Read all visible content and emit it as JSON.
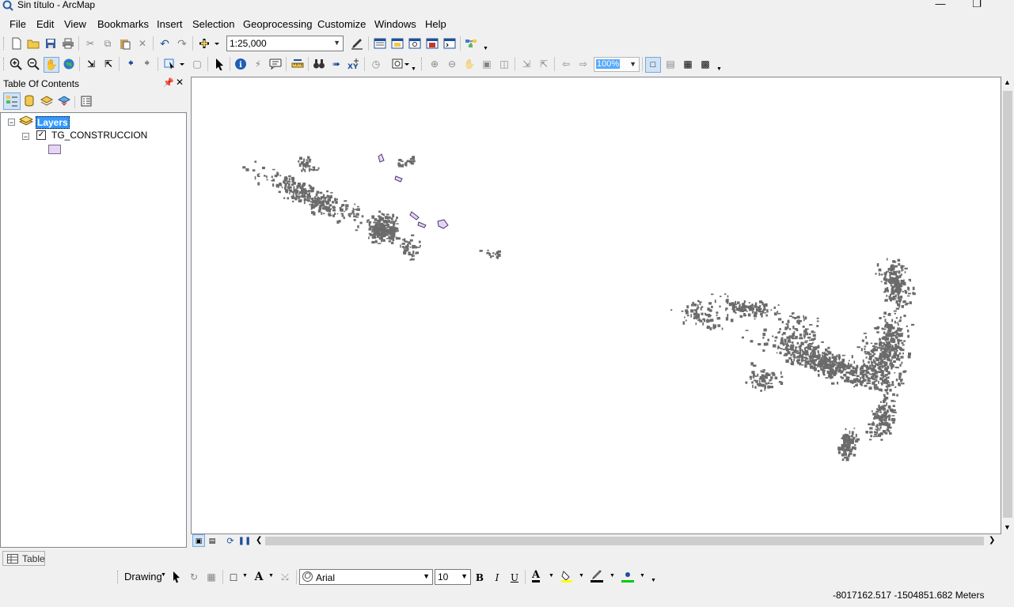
{
  "window": {
    "title": "Sin título - ArcMap",
    "controls": [
      "minimize",
      "maximize",
      "close"
    ]
  },
  "menu": [
    "File",
    "Edit",
    "View",
    "Bookmarks",
    "Insert",
    "Selection",
    "Geoprocessing",
    "Customize",
    "Windows",
    "Help"
  ],
  "standard_toolbar": {
    "scale": "1:25,000"
  },
  "layout_toolbar": {
    "zoom_percent": "100%"
  },
  "toc": {
    "title": "Table Of Contents",
    "data_frame": "Layers",
    "layer": {
      "name": "TG_CONSTRUCCION",
      "visible": true,
      "symbol_fill": "#e6d3f5"
    }
  },
  "bottom": {
    "table_tab": "Table"
  },
  "drawing_toolbar": {
    "label": "Drawing",
    "font": "Arial",
    "font_size": "10",
    "bold": "B",
    "italic": "I",
    "underline": "U",
    "font_color_letter": "A",
    "font_color": "#c00000",
    "fill_color": "#ffff00",
    "line_color": "#000000",
    "marker_color": "#00cc00"
  },
  "status": {
    "coordinates": "-8017162.517  -1504851.682 Meters"
  },
  "colors": {
    "feature_fill": "#6b6b6b",
    "highlight": "#3399ff"
  }
}
